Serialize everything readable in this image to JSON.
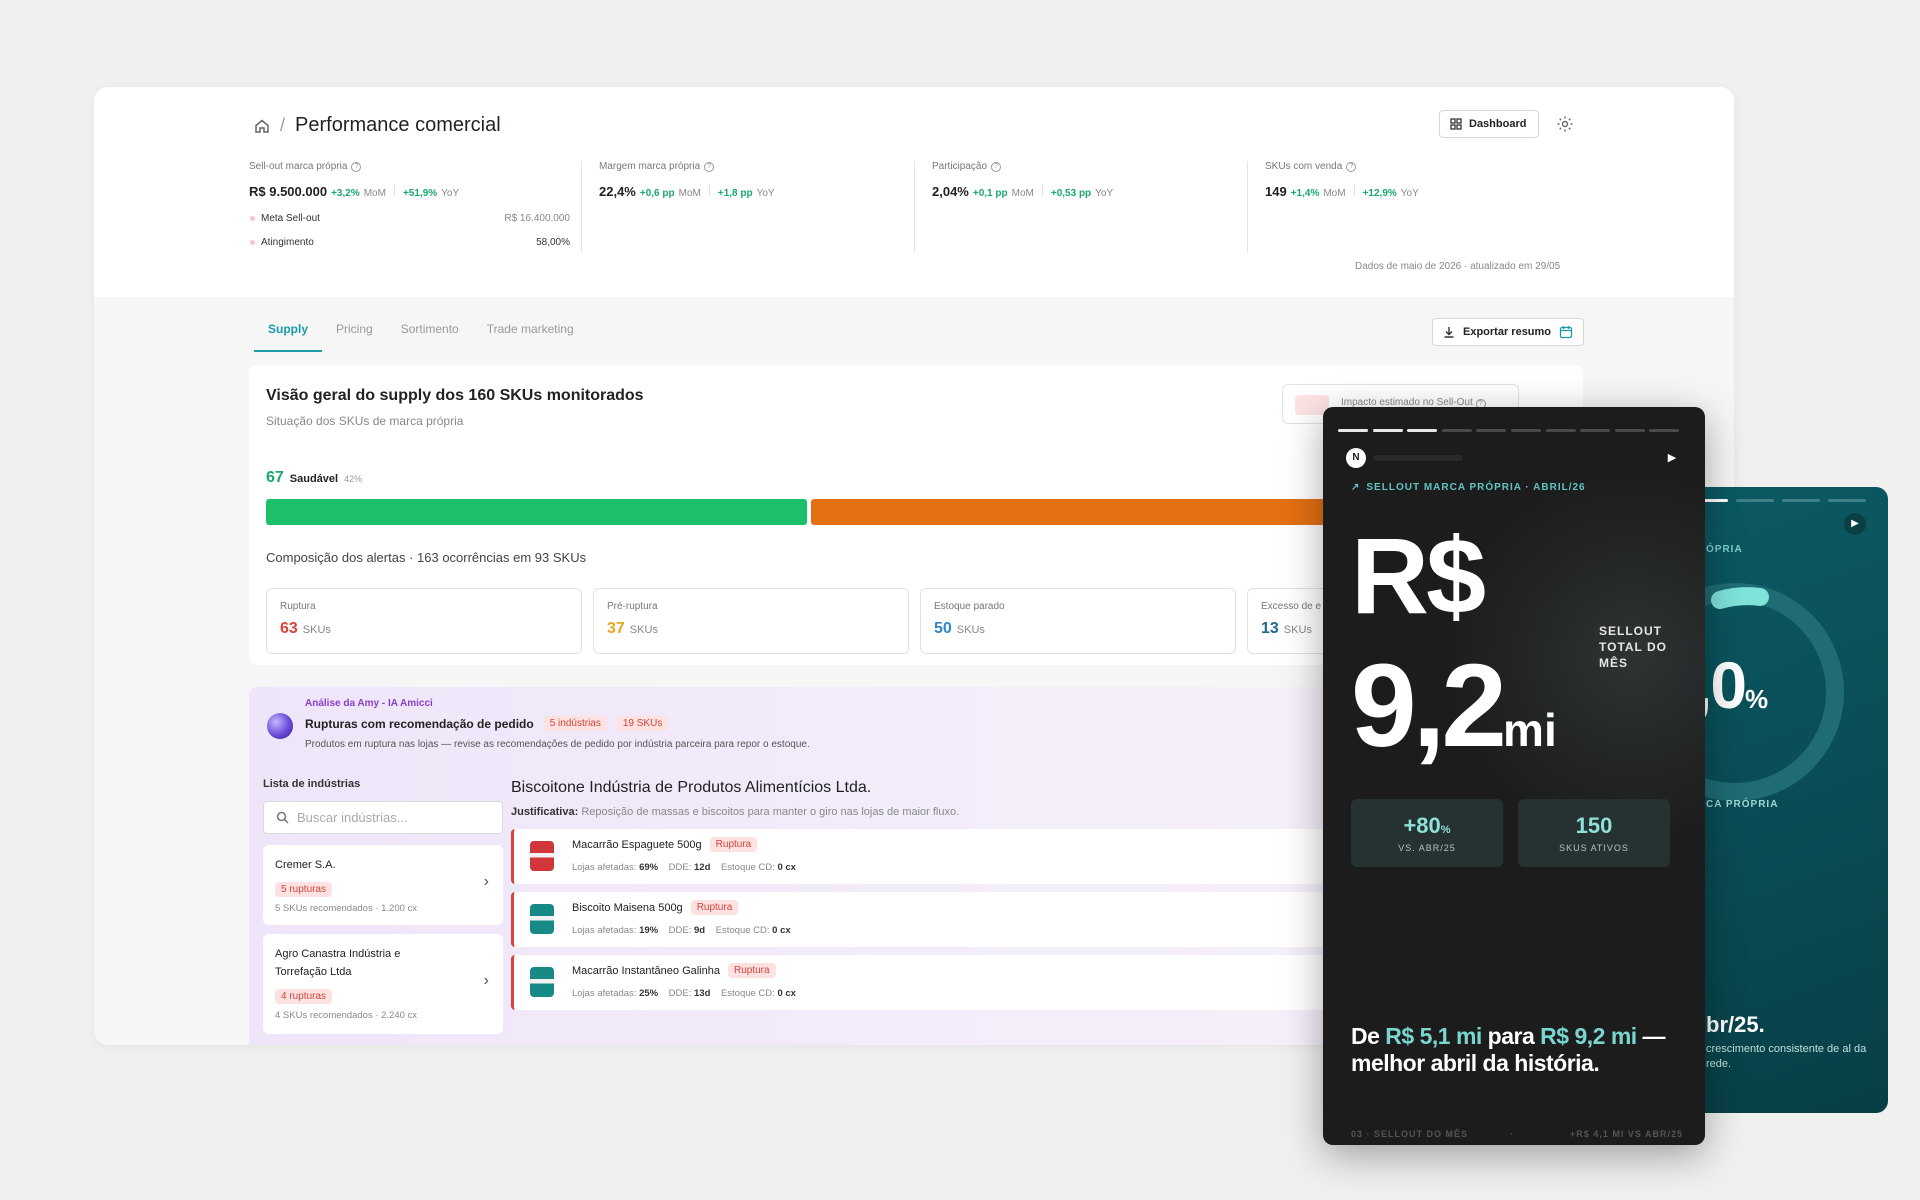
{
  "header": {
    "title": "Performance comercial",
    "dashboard_label": "Dashboard"
  },
  "kpis": [
    {
      "label": "Sell-out marca própria",
      "value": "R$ 9.500.000",
      "mom": "+3,2%",
      "mom_label": "MoM",
      "yoy": "+51,9%",
      "yoy_label": "YoY"
    },
    {
      "label": "Margem marca própria",
      "value": "22,4%",
      "mom": "+0,6 pp",
      "mom_label": "MoM",
      "yoy": "+1,8 pp",
      "yoy_label": "YoY"
    },
    {
      "label": "Participação",
      "value": "2,04%",
      "mom": "+0,1 pp",
      "mom_label": "MoM",
      "yoy": "+0,53 pp",
      "yoy_label": "YoY"
    },
    {
      "label": "SKUs com venda",
      "value": "149",
      "mom": "+1,4%",
      "mom_label": "MoM",
      "yoy": "+12,9%",
      "yoy_label": "YoY"
    }
  ],
  "meta": {
    "label": "Meta Sell-out",
    "value": "R$ 16.400.000"
  },
  "atingimento": {
    "label": "Atingimento",
    "value": "58,00%"
  },
  "updated": "Dados de maio de 2026 · atualizado em 29/05",
  "tabs": [
    "Supply",
    "Pricing",
    "Sortimento",
    "Trade marketing"
  ],
  "export_label": "Exportar resumo",
  "supply": {
    "title": "Visão geral do supply dos 160 SKUs monitorados",
    "subtitle": "Situação dos SKUs de marca própria",
    "impact_label": "Impacto estimado no Sell-Out",
    "healthy_count": "67",
    "healthy_label": "Saudável",
    "healthy_pct": "42%",
    "composition": "Composição dos alertas · 163 ocorrências em 93 SKUs",
    "alerts": [
      {
        "label": "Ruptura",
        "value": "63",
        "unit": "SKUs",
        "color": "#d6453b"
      },
      {
        "label": "Pré-ruptura",
        "value": "37",
        "unit": "SKUs",
        "color": "#e8a71a"
      },
      {
        "label": "Estoque parado",
        "value": "50",
        "unit": "SKUs",
        "color": "#2f86c9"
      },
      {
        "label": "Excesso de e",
        "value": "13",
        "unit": "SKUs",
        "color": "#1f6a8a"
      }
    ],
    "colors": {
      "healthy": "#1ebf6b",
      "warning": "#e36f12"
    }
  },
  "amy": {
    "by": "Análise da Amy - IA Amicci",
    "title": "Rupturas com recomendação de pedido",
    "pill_industries": "5 indústrias",
    "pill_skus": "19 SKUs",
    "desc": "Produtos em ruptura nas lojas — revise as recomendações de pedido por indústria parceira para repor o estoque.",
    "list_label": "Lista de indústrias",
    "search_placeholder": "Buscar indústrias...",
    "industries": [
      {
        "name": "Cremer S.A.",
        "ruptures": "5 rupturas",
        "meta": "5 SKUs recomendados · 1.200 cx"
      },
      {
        "name": "Agro Canastra Indústria e Torrefação Ltda",
        "ruptures": "4 rupturas",
        "meta": "4 SKUs recomendados · 2.240 cx"
      }
    ],
    "selected_industry": "Biscoitone Indústria de Produtos Alimentícios Ltda.",
    "justification_label": "Justificativa:",
    "justification": "Reposição de massas e biscoitos para manter o giro nas lojas de maior fluxo.",
    "products": [
      {
        "name": "Macarrão Espaguete 500g",
        "tag": "Ruptura",
        "lojas": "69%",
        "dde": "12d",
        "estoque": "0 cx",
        "icon_color": "#d0363a"
      },
      {
        "name": "Biscoito Maisena 500g",
        "tag": "Ruptura",
        "lojas": "19%",
        "dde": "9d",
        "estoque": "0 cx",
        "icon_color": "#178a87"
      },
      {
        "name": "Macarrão Instantâneo Galinha",
        "tag": "Ruptura",
        "lojas": "25%",
        "dde": "13d",
        "estoque": "0 cx",
        "icon_color": "#178a87"
      }
    ],
    "labels": {
      "lojas": "Lojas afetadas:",
      "dde": "DDE:",
      "estoque": "Estoque CD:"
    }
  },
  "story": {
    "avatar": "N",
    "kicker": "SELLOUT MARCA PRÓPRIA · ABRIL/26",
    "big_currency": "R$",
    "big_value": "9,2",
    "big_unit": "mi",
    "side_label": "SELLOUT TOTAL DO MÊS",
    "stats": [
      {
        "value": "+80",
        "suffix": "%",
        "label": "VS. ABR/25"
      },
      {
        "value": "150",
        "suffix": "",
        "label": "SKUS ATIVOS"
      }
    ],
    "headline_pre": "De ",
    "headline_a": "R$ 5,1 mi",
    "headline_mid": " para ",
    "headline_b": "R$ 9,2 mi",
    "headline_post": " — melhor abril da história.",
    "footer_left": "03 · SELLOUT DO MÊS",
    "footer_right": "+R$ 4,1 MI VS ABR/25",
    "progress_done": 3,
    "progress_total": 10
  },
  "story2": {
    "kicker": "ÓPRIA",
    "big": ",0",
    "big_suffix": "%",
    "label": "CA PRÓPRIA",
    "heading": "br/25.",
    "text": "crescimento consistente de al da rede."
  }
}
